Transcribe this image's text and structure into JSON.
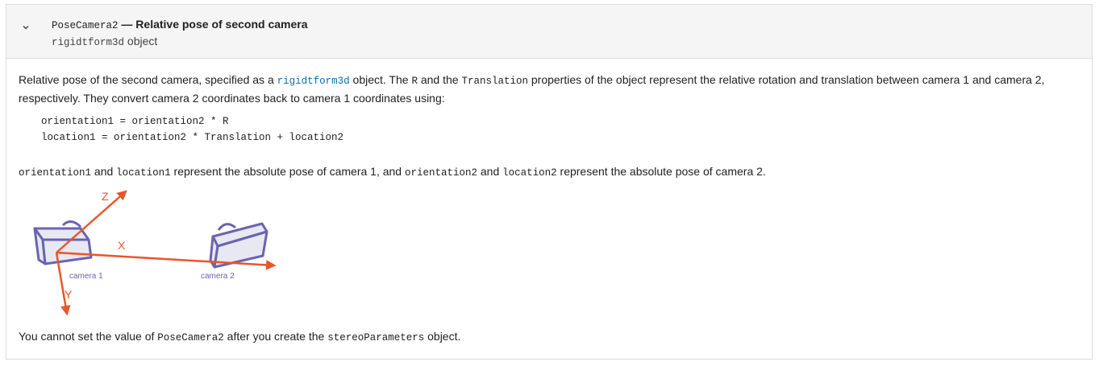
{
  "header": {
    "prop_name": "PoseCamera2",
    "title_rest": " — Relative pose of second camera",
    "type_code": "rigidtform3d",
    "type_suffix": " object",
    "expand_icon": "chevron-down-icon"
  },
  "description": {
    "p1_a": "Relative pose of the second camera, specified as a ",
    "p1_link": "rigidtform3d",
    "p1_b": " object. The ",
    "p1_code_r": "R",
    "p1_c": " and the ",
    "p1_code_t": "Translation",
    "p1_d": " properties of the object represent the relative rotation and translation between camera 1 and camera 2, respectively. They convert camera 2 coordinates back to camera 1 coordinates using:",
    "code_line1": "orientation1 = orientation2 * R",
    "code_line2": "location1 = orientation2 * Translation + location2",
    "p2_code1": "orientation1",
    "p2_a": " and ",
    "p2_code2": "location1",
    "p2_b": " represent the absolute pose of camera 1, and ",
    "p2_code3": "orientation2",
    "p2_c": " and ",
    "p2_code4": "location2",
    "p2_d": " represent the absolute pose of camera 2.",
    "p3_a": "You cannot set the value of ",
    "p3_code1": "PoseCamera2",
    "p3_b": " after you create the ",
    "p3_code2": "stereoParameters",
    "p3_c": " object."
  },
  "diagram": {
    "axis_z": "Z",
    "axis_x": "X",
    "axis_y": "Y",
    "camera1_label": "camera 1",
    "camera2_label": "camera 2",
    "axis_color": "#e8562a",
    "camera_color": "#6b63b0",
    "camera_fill": "#e8e8f2"
  }
}
